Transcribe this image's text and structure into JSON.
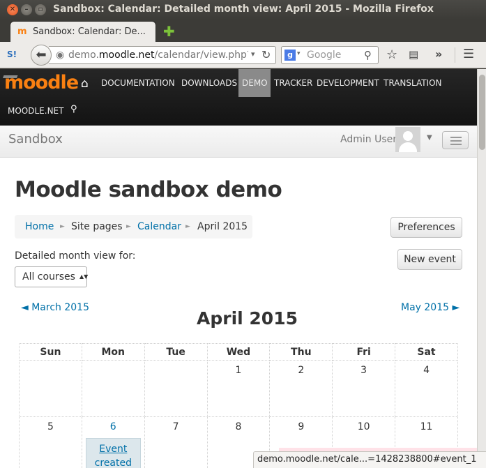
{
  "window": {
    "title": "Sandbox: Calendar: Detailed month view: April 2015 - Mozilla Firefox",
    "close_glyph": "✕",
    "min_glyph": "–",
    "max_glyph": "▫"
  },
  "tab": {
    "label": "Sandbox: Calendar: De...",
    "icon": "moodle-favicon",
    "icon_glyph": "m",
    "new_tab_glyph": "✚"
  },
  "toolbar": {
    "url_prefix": "demo.",
    "url_domain": "moodle.net",
    "url_suffix": "/calendar/view.php?v",
    "search_placeholder": "Google",
    "sync_glyph": "S!",
    "back_glyph": "⬅",
    "globe_glyph": "◉",
    "url_drop_glyph": "▾",
    "reload_glyph": "↻",
    "g_glyph": "g",
    "search_drop_glyph": "▾",
    "magnifier_glyph": "⚲",
    "star_glyph": "☆",
    "reading_glyph": "▤",
    "overflow_glyph": "»",
    "menu_glyph": "☰"
  },
  "site_nav": {
    "logo": "moodle",
    "home_glyph": "⌂",
    "search_glyph": "⚲",
    "items": [
      {
        "label": "DOCUMENTATION"
      },
      {
        "label": "DOWNLOADS"
      },
      {
        "label": "DEMO"
      },
      {
        "label": "TRACKER"
      },
      {
        "label": "DEVELOPMENT"
      },
      {
        "label": "TRANSLATION"
      },
      {
        "label": "MOODLE.NET"
      }
    ]
  },
  "header": {
    "site_name": "Sandbox",
    "user_name": "Admin User",
    "user_caret_glyph": "▼"
  },
  "page": {
    "title": "Moodle sandbox demo",
    "breadcrumb": [
      "Home",
      "Site pages",
      "Calendar",
      "April 2015"
    ],
    "breadcrumb_sep": "►",
    "preferences_label": "Preferences",
    "new_event_label": "New event",
    "view_label": "Detailed month view for:",
    "course_select_value": "All courses",
    "course_select_caret": "▲▼"
  },
  "calendar": {
    "prev_month": "◄ March 2015",
    "next_month": "May 2015 ►",
    "month_title": "April 2015",
    "weekdays": [
      "Sun",
      "Mon",
      "Tue",
      "Wed",
      "Thu",
      "Fri",
      "Sat"
    ],
    "week1": [
      "",
      "",
      "",
      "1",
      "2",
      "3",
      "4"
    ],
    "week2": [
      "5",
      "6",
      "7",
      "8",
      "9",
      "10",
      "11"
    ],
    "event": {
      "link": "Event",
      "text": "created"
    }
  },
  "status_bar": {
    "text": "demo.moodle.net/cale...=1428238800#event_1"
  },
  "colors": {
    "moodle_orange": "#f98012",
    "link_blue": "#0070a8",
    "nav_dark": "#1b1b1b",
    "demo_active": "#8a8a8a"
  }
}
